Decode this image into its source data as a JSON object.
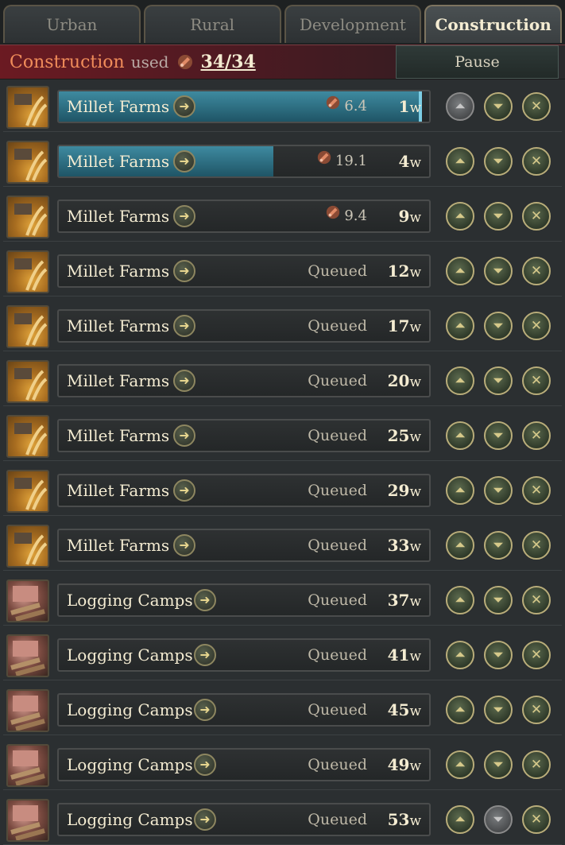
{
  "tabs": [
    "Urban",
    "Rural",
    "Development",
    "Construction"
  ],
  "header": {
    "title": "Construction",
    "used_label": "used",
    "count": "34/34",
    "pause_label": "Pause"
  },
  "week_unit": "w",
  "rows": [
    {
      "name": "Millet Farms",
      "type": "farm",
      "cost": "6.4",
      "weeks": "1",
      "progress": 0.98,
      "up_disabled": true,
      "down_disabled": false
    },
    {
      "name": "Millet Farms",
      "type": "farm",
      "cost": "19.1",
      "weeks": "4",
      "progress": 0.58,
      "up_disabled": false,
      "down_disabled": false
    },
    {
      "name": "Millet Farms",
      "type": "farm",
      "cost": "9.4",
      "weeks": "9",
      "progress": 0,
      "up_disabled": false,
      "down_disabled": false
    },
    {
      "name": "Millet Farms",
      "type": "farm",
      "status": "Queued",
      "weeks": "12",
      "progress": 0,
      "up_disabled": false,
      "down_disabled": false
    },
    {
      "name": "Millet Farms",
      "type": "farm",
      "status": "Queued",
      "weeks": "17",
      "progress": 0,
      "up_disabled": false,
      "down_disabled": false
    },
    {
      "name": "Millet Farms",
      "type": "farm",
      "status": "Queued",
      "weeks": "20",
      "progress": 0,
      "up_disabled": false,
      "down_disabled": false
    },
    {
      "name": "Millet Farms",
      "type": "farm",
      "status": "Queued",
      "weeks": "25",
      "progress": 0,
      "up_disabled": false,
      "down_disabled": false
    },
    {
      "name": "Millet Farms",
      "type": "farm",
      "status": "Queued",
      "weeks": "29",
      "progress": 0,
      "up_disabled": false,
      "down_disabled": false
    },
    {
      "name": "Millet Farms",
      "type": "farm",
      "status": "Queued",
      "weeks": "33",
      "progress": 0,
      "up_disabled": false,
      "down_disabled": false
    },
    {
      "name": "Logging Camps",
      "type": "logging",
      "status": "Queued",
      "weeks": "37",
      "progress": 0,
      "up_disabled": false,
      "down_disabled": false
    },
    {
      "name": "Logging Camps",
      "type": "logging",
      "status": "Queued",
      "weeks": "41",
      "progress": 0,
      "up_disabled": false,
      "down_disabled": false
    },
    {
      "name": "Logging Camps",
      "type": "logging",
      "status": "Queued",
      "weeks": "45",
      "progress": 0,
      "up_disabled": false,
      "down_disabled": false
    },
    {
      "name": "Logging Camps",
      "type": "logging",
      "status": "Queued",
      "weeks": "49",
      "progress": 0,
      "up_disabled": false,
      "down_disabled": false
    },
    {
      "name": "Logging Camps",
      "type": "logging",
      "status": "Queued",
      "weeks": "53",
      "progress": 0,
      "up_disabled": false,
      "down_disabled": true
    }
  ],
  "icons": {
    "construction": "construction-points-icon",
    "go_to": "arrow-right-icon",
    "up": "move-up-icon",
    "down": "move-down-icon",
    "cancel": "cancel-icon"
  },
  "colors": {
    "header_accent": "#f08c5a",
    "progress_fill": "#2f7a92"
  }
}
